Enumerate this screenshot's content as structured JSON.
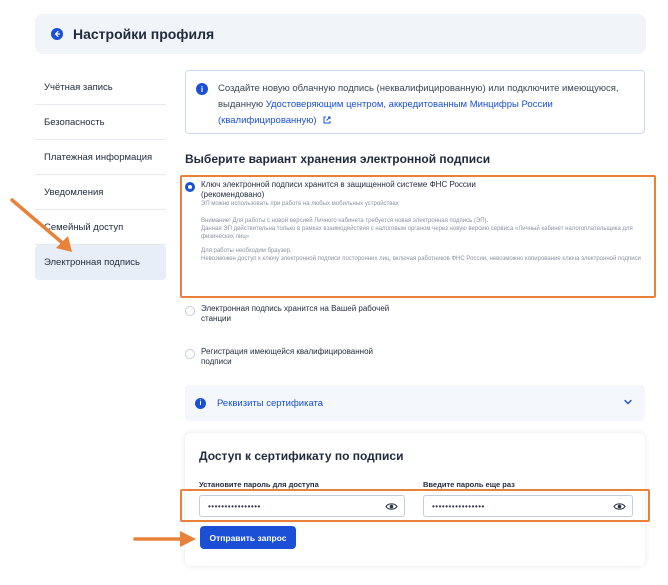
{
  "header": {
    "title": "Настройки профиля",
    "back_icon": "arrow-left-icon"
  },
  "sidebar": {
    "items": [
      {
        "label": "Учётная запись"
      },
      {
        "label": "Безопасность"
      },
      {
        "label": "Платежная информация"
      },
      {
        "label": "Уведомления"
      },
      {
        "label": "Семейный доступ"
      },
      {
        "label": "Электронная подпись",
        "active": true
      }
    ]
  },
  "info": {
    "text_before": "Создайте новую облачную подпись (неквалифицированную) или подключите имеющуюся, выданную ",
    "link_text": "Удостоверяющим центром, аккредитованным Минцифры России (квалифицированную)",
    "icon": "info-icon"
  },
  "storage": {
    "title": "Выберите вариант хранения электронной подписи",
    "options": [
      {
        "title": "Ключ электронной подписи хранится в защищенной системе ФНС России (рекомендовано)",
        "lines": [
          "ЭП можно использовать при работе на любых мобильных устройствах",
          "Внимание! Для работы с новой версией Личного кабинета требуется новая электронная подпись (ЭП).",
          "Данная ЭП действительна только в рамках взаимодействия с налоговым органом через новую версию сервиса «Личный кабинет налогоплательщика для физических лиц»",
          "Для работы необходим браузер.",
          "Невозможен доступ к ключу электронной подписи посторонних лиц, включая работников ФНС России, невозможно копирование ключа электронной подписи"
        ],
        "checked": true
      },
      {
        "title": "Электронная подпись хранится на Вашей рабочей станции",
        "checked": false
      },
      {
        "title": "Регистрация имеющейся квалифицированной подписи",
        "checked": false
      }
    ]
  },
  "accordion": {
    "label": "Реквизиты сертификата"
  },
  "access": {
    "title": "Доступ к сертификату по подписи",
    "password_label": "Установите пароль для доступа",
    "password_value": "••••••••••••••••",
    "repeat_label": "Введите пароль еще раз",
    "repeat_value": "••••••••••••••••",
    "submit_label": "Отправить запрос"
  },
  "colors": {
    "accent": "#1a4fd6",
    "highlight": "#e8823a",
    "header_bg": "#f1f4f8"
  }
}
